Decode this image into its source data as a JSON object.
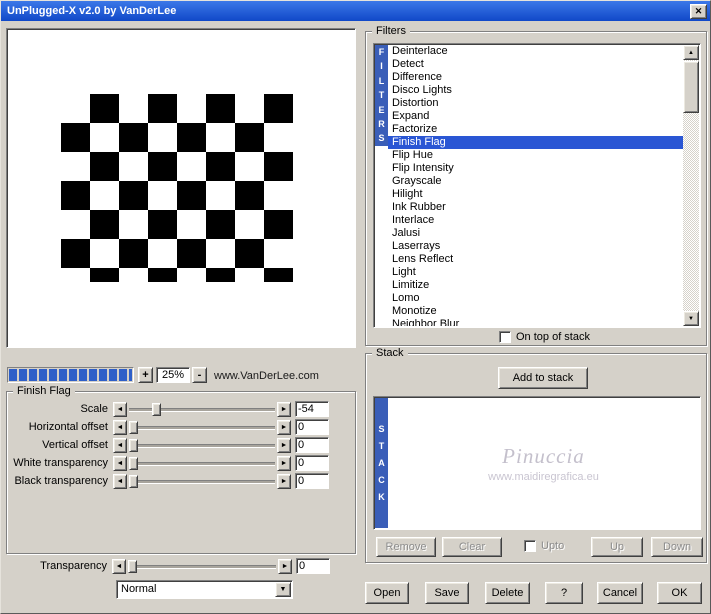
{
  "window": {
    "title": "UnPlugged-X v2.0 by VanDerLee"
  },
  "icons": {
    "close": "✕",
    "left": "◄",
    "right": "►",
    "up": "▲",
    "down": "▼",
    "dropdown": "▼"
  },
  "colors": {
    "dialog_bg": "#D5D1C9",
    "titlebar_top": "#3C78E8",
    "titlebar_bottom": "#1048C8",
    "selection": "#2A56D4",
    "strip": "#3A5EB8",
    "progress": "#2E5FC8",
    "watermark": "#C4C0CC"
  },
  "preview": {
    "zoom_in": "+",
    "zoom_level": "25%",
    "zoom_out": "-",
    "website": "www.VanDerLee.com"
  },
  "filters": {
    "group_label": "Filters",
    "strip_text": "FILTERS",
    "selected": "Finish Flag",
    "on_top_checkbox_label": "On top of stack",
    "on_top_checked": false,
    "items": [
      "Deinterlace",
      "Detect",
      "Difference",
      "Disco Lights",
      "Distortion",
      "Expand",
      "Factorize",
      "Finish Flag",
      "Flip Hue",
      "Flip Intensity",
      "Grayscale",
      "Hilight",
      "Ink Rubber",
      "Interlace",
      "Jalusi",
      "Laserrays",
      "Lens Reflect",
      "Light",
      "Limitize",
      "Lomo",
      "Monotize",
      "Neighbor Blur"
    ]
  },
  "params": {
    "group_label": "Finish Flag",
    "sliders": [
      {
        "label": "Scale",
        "value": "-54",
        "pos": 16
      },
      {
        "label": "Horizontal offset",
        "value": "0",
        "pos": 0
      },
      {
        "label": "Vertical offset",
        "value": "0",
        "pos": 0
      },
      {
        "label": "White transparency",
        "value": "0",
        "pos": 0
      },
      {
        "label": "Black transparency",
        "value": "0",
        "pos": 0
      }
    ],
    "transparency": {
      "label": "Transparency",
      "value": "0",
      "pos": 0
    },
    "blend_mode_value": "Normal"
  },
  "stack": {
    "group_label": "Stack",
    "strip_text": "STACK",
    "add_button_label": "Add to stack",
    "watermark": {
      "title": "Pinuccia",
      "subtitle": "www.maidiregrafica.eu"
    },
    "remove_label": "Remove",
    "clear_label": "Clear",
    "upto_label": "Upto",
    "upto_checked": false,
    "up_label": "Up",
    "down_label": "Down"
  },
  "footer": {
    "open": "Open",
    "save": "Save",
    "delete": "Delete",
    "help": "?",
    "cancel": "Cancel",
    "ok": "OK"
  }
}
